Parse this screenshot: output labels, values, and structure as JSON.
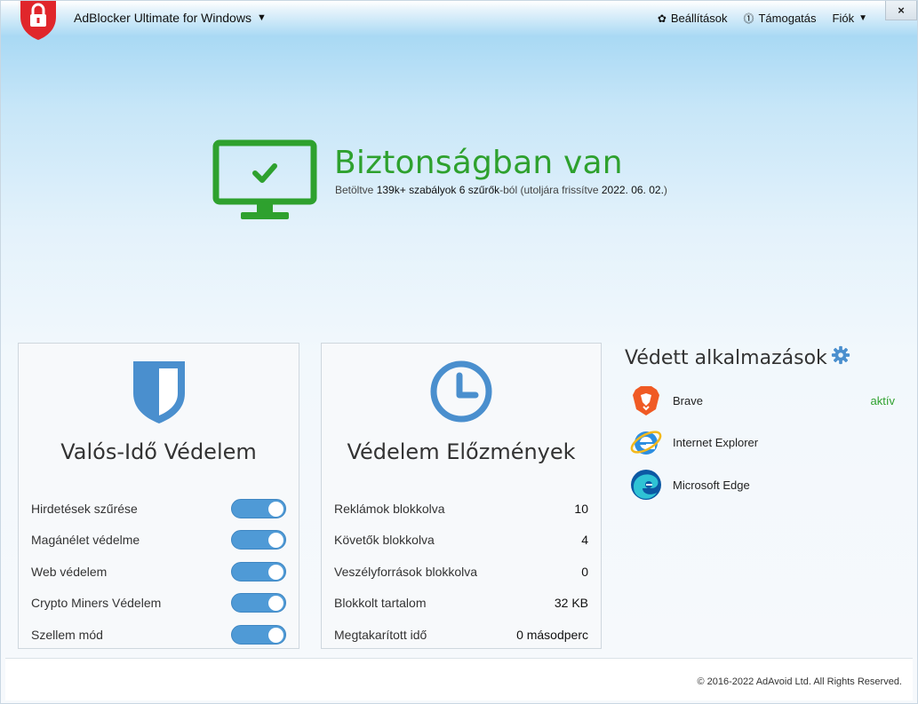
{
  "header": {
    "app_title": "AdBlocker Ultimate for Windows",
    "menu": [
      {
        "label": "Beállítások",
        "icon": "gear-icon"
      },
      {
        "label": "Támogatás",
        "icon": "help-icon"
      },
      {
        "label": "Fiók",
        "icon": "chevron-down-icon"
      }
    ],
    "close_label": "×"
  },
  "status": {
    "title": "Biztonságban van",
    "sub_prefix": "Betöltve ",
    "rules_count": "139k+ szabályok",
    "sub_mid1": " ",
    "filters_count": "6 szűrők",
    "sub_mid2": "-ból (utoljára frissítve ",
    "updated_date": "2022. 06. 02.",
    "sub_suffix": ")"
  },
  "realtime": {
    "title": "Valós-Idő Védelem",
    "items": [
      {
        "label": "Hirdetések szűrése",
        "enabled": true
      },
      {
        "label": "Magánélet védelme",
        "enabled": true
      },
      {
        "label": "Web védelem",
        "enabled": true
      },
      {
        "label": "Crypto Miners Védelem",
        "enabled": true
      },
      {
        "label": "Szellem mód",
        "enabled": true
      }
    ]
  },
  "history": {
    "title": "Védelem Előzmények",
    "items": [
      {
        "label": "Reklámok blokkolva",
        "value": "10"
      },
      {
        "label": "Követők blokkolva",
        "value": "4"
      },
      {
        "label": "Veszélyforrások blokkolva",
        "value": "0"
      },
      {
        "label": "Blokkolt tartalom",
        "value": "32 KB"
      },
      {
        "label": "Megtakarított idő",
        "value": "0 másodperc"
      }
    ]
  },
  "apps": {
    "title": "Védett alkalmazások",
    "items": [
      {
        "name": "Brave",
        "status": "aktív",
        "icon": "brave-icon"
      },
      {
        "name": "Internet Explorer",
        "status": "",
        "icon": "internet-explorer-icon"
      },
      {
        "name": "Microsoft Edge",
        "status": "",
        "icon": "microsoft-edge-icon"
      }
    ]
  },
  "footer": {
    "copyright": "© 2016-2022 AdAvoid Ltd. All Rights Reserved."
  },
  "colors": {
    "accent_green": "#2ea12e",
    "toggle_blue": "#4f9ad6",
    "brand_red": "#e0262b",
    "icon_blue": "#4a8fce"
  }
}
